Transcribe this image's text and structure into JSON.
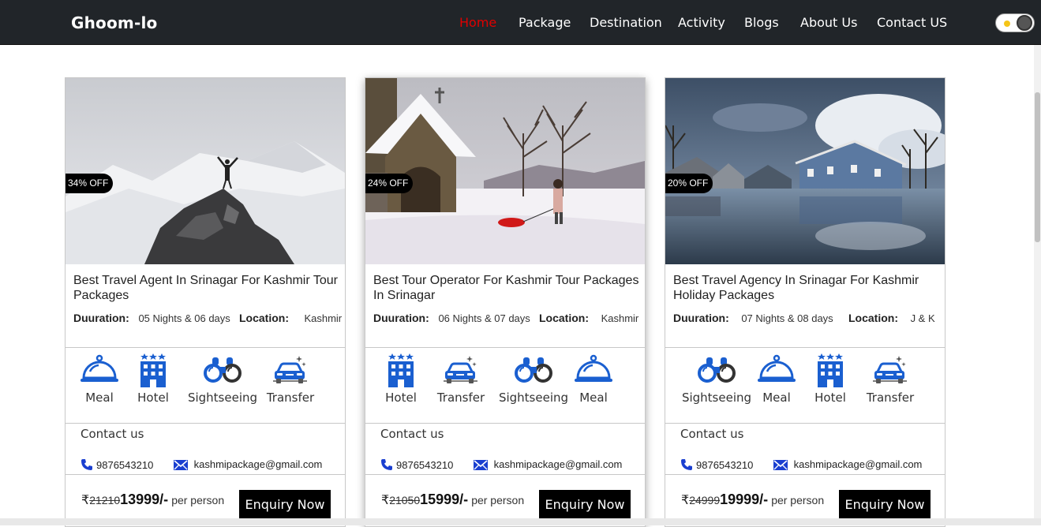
{
  "nav": {
    "brand": "Ghoom-lo",
    "items": [
      {
        "label": "Home",
        "active": true
      },
      {
        "label": "Package",
        "active": false
      },
      {
        "label": "Destination",
        "active": false
      },
      {
        "label": "Activity",
        "active": false
      },
      {
        "label": "Blogs",
        "active": false
      },
      {
        "label": "About Us",
        "active": false
      },
      {
        "label": "Contact US",
        "active": false
      }
    ],
    "active_color": "#e00000",
    "theme_toggle_icon": "sun-icon"
  },
  "contact_head": "Contact us",
  "cards": [
    {
      "image_icon": "snow-mountain-photo",
      "discount": "34% OFF",
      "title": "Best Travel Agent In Srinagar For Kashmir Tour Packages",
      "duration_label": "Duuration:",
      "duration": "05 Nights & 06 days",
      "location_label": "Location:",
      "location": "Kashmir",
      "features": [
        {
          "label": "Meal",
          "icon": "meal-cloche-icon"
        },
        {
          "label": "Hotel",
          "icon": "hotel-icon"
        },
        {
          "label": "Sightseeing",
          "icon": "binoculars-icon"
        },
        {
          "label": "Transfer",
          "icon": "car-icon"
        }
      ],
      "phone": "9876543210",
      "email": "kashmipackage@gmail.com",
      "currency": "₹",
      "old_price": "21210",
      "new_price": "13999/-",
      "per": "per person",
      "button": "Enquiry Now"
    },
    {
      "image_icon": "snow-chapel-photo",
      "discount": "24% OFF",
      "title": "Best Tour Operator For Kashmir Tour Packages In Srinagar",
      "duration_label": "Duuration:",
      "duration": "06 Nights & 07 days",
      "location_label": "Location:",
      "location": "Kashmir",
      "features": [
        {
          "label": "Hotel",
          "icon": "hotel-icon"
        },
        {
          "label": "Transfer",
          "icon": "car-icon"
        },
        {
          "label": "Sightseeing",
          "icon": "binoculars-icon"
        },
        {
          "label": "Meal",
          "icon": "meal-cloche-icon"
        }
      ],
      "phone": "9876543210",
      "email": "kashmipackage@gmail.com",
      "currency": "₹",
      "old_price": "21050",
      "new_price": "15999/-",
      "per": "per person",
      "button": "Enquiry Now"
    },
    {
      "image_icon": "lake-houses-photo",
      "discount": "20% OFF",
      "title": "Best Travel Agency In Srinagar For Kashmir Holiday Packages",
      "duration_label": "Duuration:",
      "duration": "07 Nights & 08 days",
      "location_label": "Location:",
      "location": "J & K",
      "features": [
        {
          "label": "Sightseeing",
          "icon": "binoculars-icon"
        },
        {
          "label": "Meal",
          "icon": "meal-cloche-icon"
        },
        {
          "label": "Hotel",
          "icon": "hotel-icon"
        },
        {
          "label": "Transfer",
          "icon": "car-icon"
        }
      ],
      "phone": "9876543210",
      "email": "kashmipackage@gmail.com",
      "currency": "₹",
      "old_price": "24999",
      "new_price": "19999/-",
      "per": "per person",
      "button": "Enquiry Now"
    }
  ],
  "colors": {
    "navbar_bg": "#212529",
    "icon_blue": "#1a5fd0",
    "button_bg": "#000000"
  }
}
